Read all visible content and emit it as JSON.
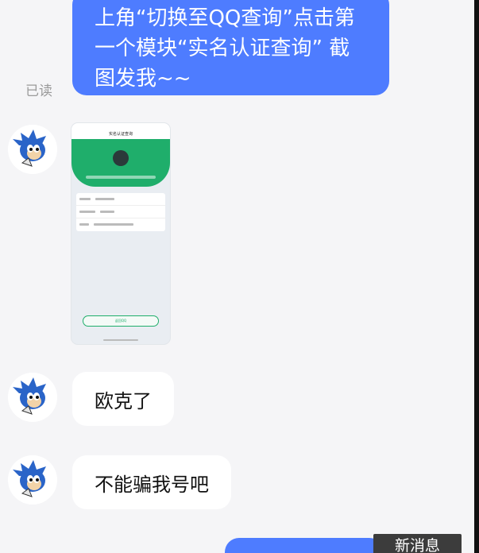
{
  "messages": {
    "outgoing_1": "上角“切换至QQ查询”点击第一个模块“实名认证查询” 截图发我~~",
    "read_status": "已读",
    "incoming_ok": "欧克了",
    "incoming_no_scam": "不能骗我号吧"
  },
  "screenshot": {
    "title": "实名认证查询",
    "button": "返回QQ"
  },
  "new_message_badge": "新消息",
  "colors": {
    "bubble_out": "#4e7cff",
    "bubble_in": "#ffffff",
    "background": "#f5f5f7",
    "green": "#1fae6b"
  }
}
